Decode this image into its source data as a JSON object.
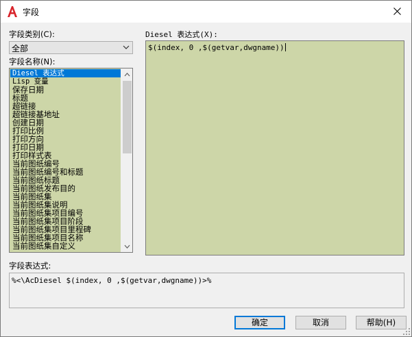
{
  "window": {
    "title": "字段",
    "icon": "autocad-a-icon",
    "accent": "#d8232a"
  },
  "category": {
    "label": "字段类别(C):",
    "selected": "全部"
  },
  "field_names": {
    "label": "字段名称(N):",
    "items": [
      "Diesel 表达式",
      "Lisp 变量",
      "保存日期",
      "标题",
      "超链接",
      "超链接基地址",
      "创建日期",
      "打印比例",
      "打印方向",
      "打印日期",
      "打印样式表",
      "当前图纸编号",
      "当前图纸编号和标题",
      "当前图纸标题",
      "当前图纸发布目的",
      "当前图纸集",
      "当前图纸集说明",
      "当前图纸集项目编号",
      "当前图纸集项目阶段",
      "当前图纸集项目里程碑",
      "当前图纸集项目名称",
      "当前图纸集自定义"
    ],
    "selected_index": 0
  },
  "diesel": {
    "label": "Diesel 表达式(X):",
    "value": "$(index, 0 ,$(getvar,dwgname))"
  },
  "field_expression": {
    "label": "字段表达式:",
    "value": "%<\\AcDiesel $(index, 0 ,$(getvar,dwgname))>%"
  },
  "buttons": {
    "ok": "确定",
    "cancel": "取消",
    "help": "帮助(H)"
  },
  "colors": {
    "input_bg": "#cdd6a8",
    "selection": "#0078d7"
  }
}
